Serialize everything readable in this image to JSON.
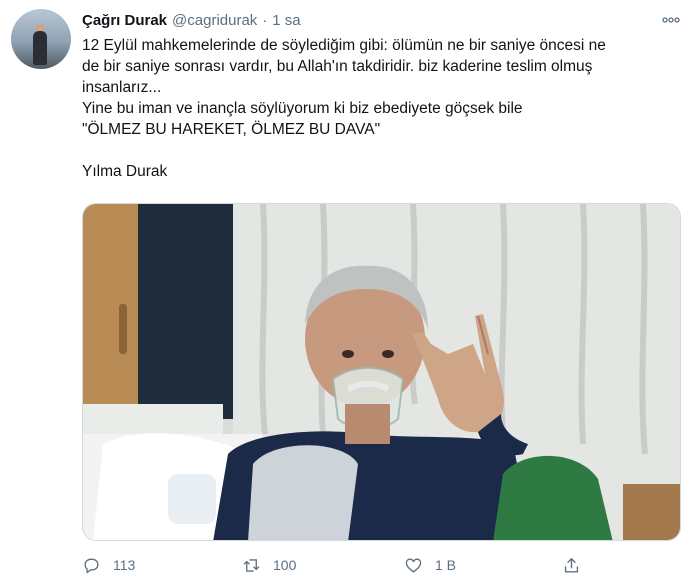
{
  "author": {
    "name": "Çağrı Durak",
    "handle": "@cagridurak",
    "separator": "·",
    "time": "1 sa"
  },
  "tweet": {
    "paragraph1": "12 Eylül mahkemelerinde de söylediğim gibi: ölümün ne bir saniye öncesi ne\nde bir saniye sonrası vardır, bu Allah'ın takdiridir. biz kaderine teslim olmuş\ninsanlarız...",
    "paragraph2": "Yine bu iman ve inançla söylüyorum ki biz ebediyete göçsek bile\n\"ÖLMEZ BU HAREKET, ÖLMEZ BU DAVA\"",
    "paragraph3": "Yılma Durak"
  },
  "actions": {
    "reply_count": "113",
    "retweet_count": "100",
    "like_count": "1 B",
    "icons": [
      "reply-icon",
      "retweet-icon",
      "like-icon",
      "share-icon"
    ]
  },
  "colors": {
    "text": "#0f1419",
    "secondary": "#5b7083",
    "border": "#cfd9de"
  }
}
